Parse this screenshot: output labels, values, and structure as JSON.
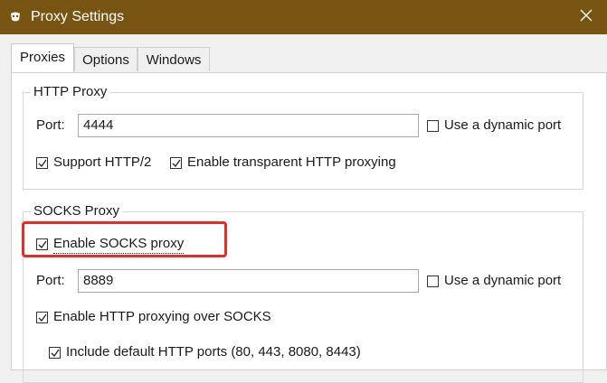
{
  "window": {
    "title": "Proxy Settings"
  },
  "tabs": [
    {
      "label": "Proxies",
      "active": true
    },
    {
      "label": "Options",
      "active": false
    },
    {
      "label": "Windows",
      "active": false
    }
  ],
  "http_proxy": {
    "legend": "HTTP Proxy",
    "port_label": "Port:",
    "port_value": "4444",
    "dynamic_port_label": "Use a dynamic port",
    "dynamic_port_checked": false,
    "http2_label": "Support HTTP/2",
    "http2_checked": true,
    "transparent_label": "Enable transparent HTTP proxying",
    "transparent_checked": true
  },
  "socks_proxy": {
    "legend": "SOCKS Proxy",
    "enable_label": "Enable SOCKS proxy",
    "enable_checked": true,
    "port_label": "Port:",
    "port_value": "8889",
    "dynamic_port_label": "Use a dynamic port",
    "dynamic_port_checked": false,
    "http_over_socks_label": "Enable HTTP proxying over SOCKS",
    "http_over_socks_checked": true,
    "default_ports_label": "Include default HTTP ports (80, 443, 8080, 8443)",
    "default_ports_checked": true
  },
  "colors": {
    "titlebar": "#775412",
    "highlight": "#e52b2b"
  },
  "icons": {
    "app": "charles-jug-icon",
    "close": "close-icon",
    "check": "checkmark-icon"
  }
}
